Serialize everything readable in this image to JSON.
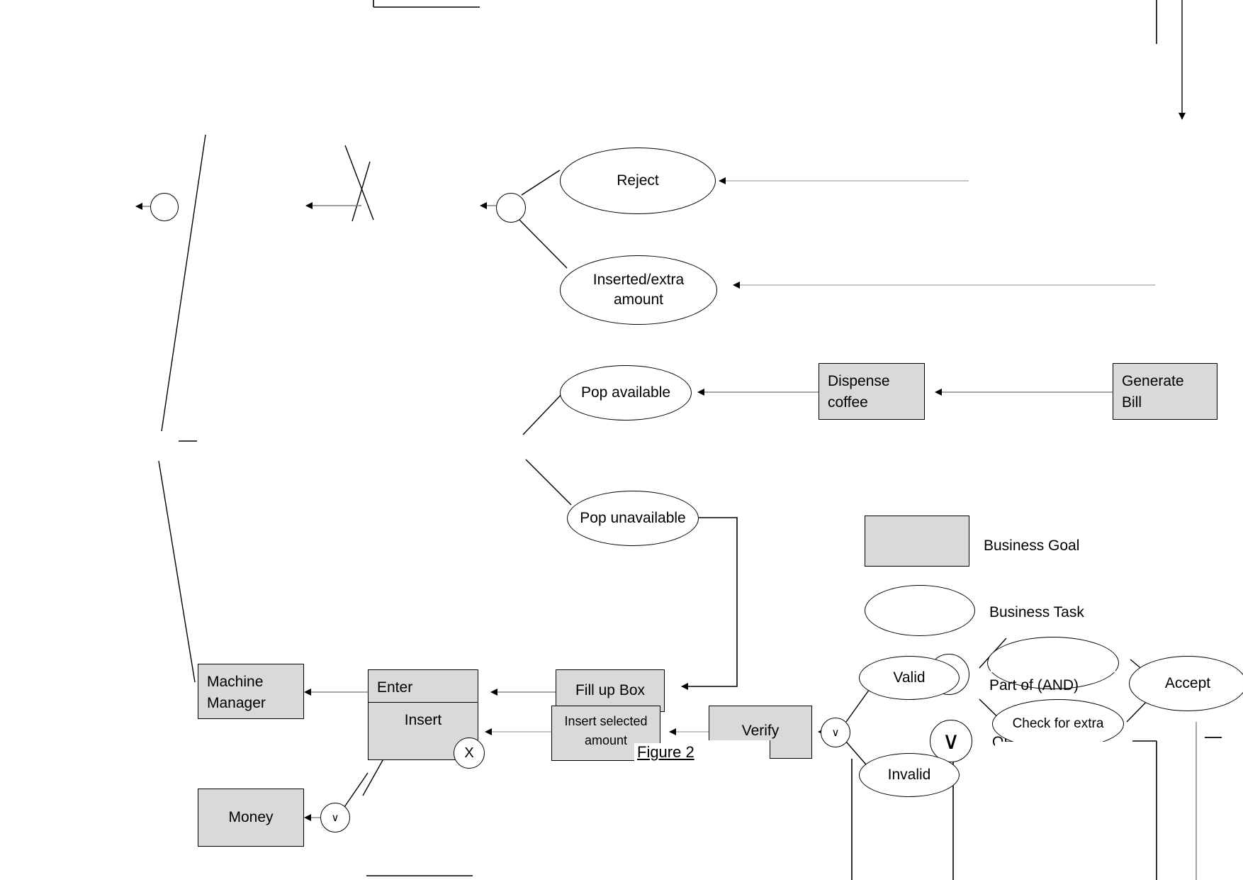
{
  "figure": {
    "caption": "Figure 2"
  },
  "legend": {
    "goal_label": "Business Goal",
    "task_label": "Business Task",
    "and_label": "Part of (AND)",
    "or_label": "OR  (Operator)",
    "and_symbol": "∧",
    "or_symbol": "∨"
  },
  "goals": [
    {
      "id": "dispense-coffee",
      "label": "Dispense\ncoffee"
    },
    {
      "id": "generate-bill",
      "label": "Generate\nBill"
    },
    {
      "id": "machine-manager",
      "label": "Machine\nManager"
    },
    {
      "id": "enter-machine-id",
      "label": "Enter\nMachine ID"
    },
    {
      "id": "insert",
      "label": "Insert"
    },
    {
      "id": "money",
      "label": "Money"
    },
    {
      "id": "fill-up-box",
      "label": "Fill up Box"
    },
    {
      "id": "insert-selected-amount",
      "label": "Insert selected\namount"
    },
    {
      "id": "verify",
      "label": "Verify"
    }
  ],
  "tasks": [
    {
      "id": "reject",
      "label": "Reject"
    },
    {
      "id": "inserted-extra",
      "label": "Inserted/extra\namount"
    },
    {
      "id": "pop-available",
      "label": "Pop available"
    },
    {
      "id": "pop-unavailable",
      "label": "Pop unavailable"
    },
    {
      "id": "valid",
      "label": "Valid"
    },
    {
      "id": "invalid",
      "label": "Invalid"
    },
    {
      "id": "check-for-extra",
      "label": "Check for extra"
    },
    {
      "id": "accept",
      "label": "Accept"
    }
  ],
  "operators": [
    {
      "id": "op-reject-and",
      "symbol": ""
    },
    {
      "id": "op-insert-x",
      "symbol": "X"
    },
    {
      "id": "op-money-or",
      "symbol": "∨"
    },
    {
      "id": "op-verify-or",
      "symbol": "∨"
    },
    {
      "id": "op-valid-and",
      "symbol": "∧"
    },
    {
      "id": "op-invalid-or",
      "symbol": "∨"
    },
    {
      "id": "op-topleft",
      "symbol": ""
    }
  ],
  "colors": {
    "goal_fill": "#d9d9d9",
    "stroke": "#000000",
    "background": "#ffffff",
    "wire": "#7f7f7f"
  }
}
